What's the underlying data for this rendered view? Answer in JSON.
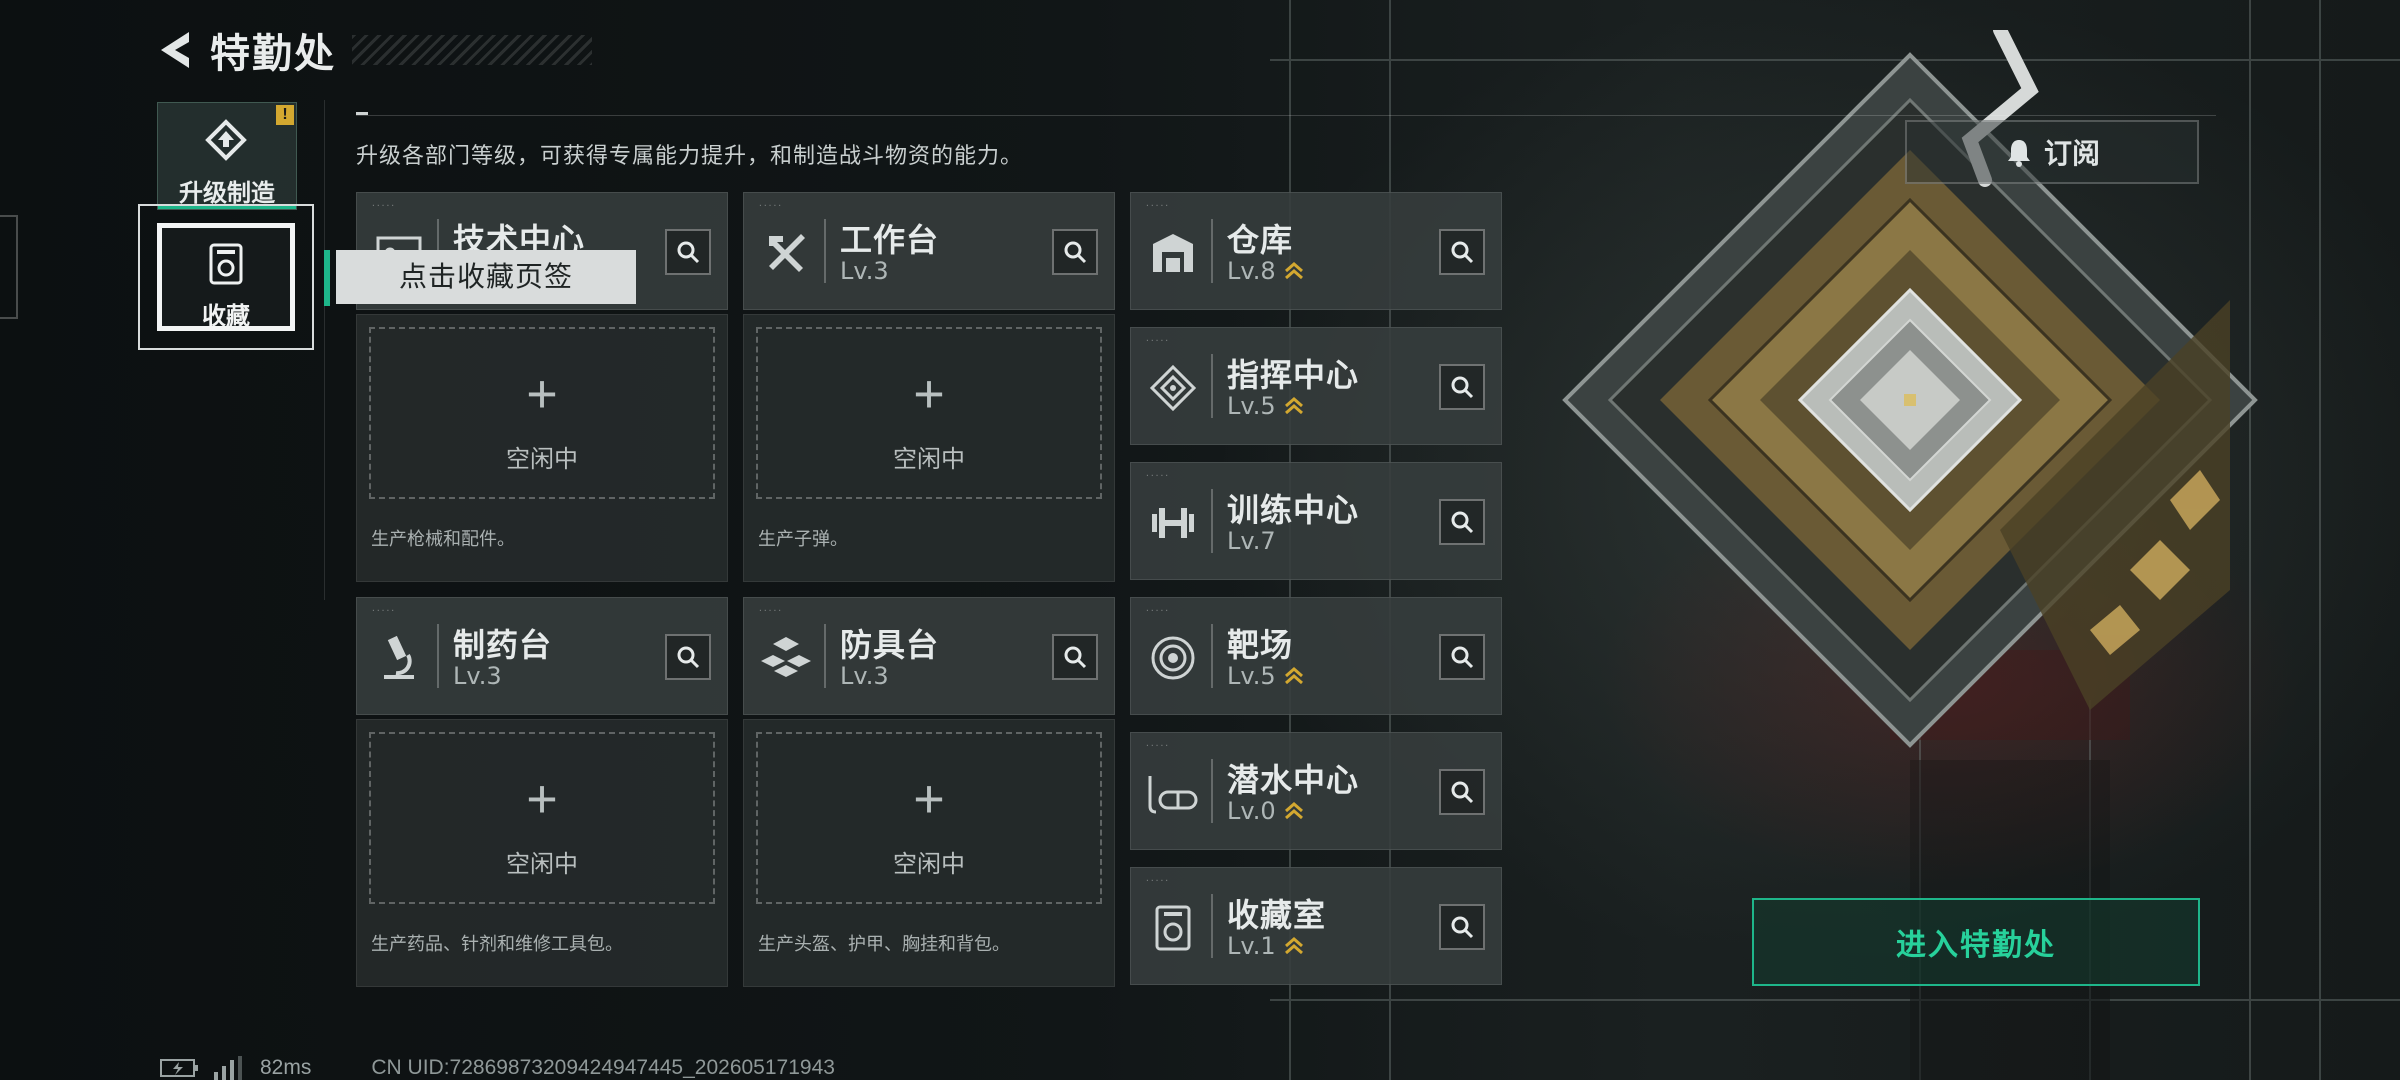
{
  "header": {
    "title": "特勤处"
  },
  "description": "升级各部门等级，可获得专属能力提升，和制造战斗物资的能力。",
  "nav": {
    "upgrade_label": "升级制造",
    "upgrade_badge": "!",
    "collect_label": "收藏"
  },
  "tooltip": "点击收藏页签",
  "subscribe_label": "订阅",
  "enter_label": "进入特勤处",
  "workshops": [
    {
      "name": "技术中心",
      "level": "",
      "idle": "空闲中",
      "note": "生产枪械和配件。"
    },
    {
      "name": "工作台",
      "level": "Lv.3",
      "idle": "空闲中",
      "note": "生产子弹。"
    },
    {
      "name": "制药台",
      "level": "Lv.3",
      "idle": "空闲中",
      "note": "生产药品、针剂和维修工具包。"
    },
    {
      "name": "防具台",
      "level": "Lv.3",
      "idle": "空闲中",
      "note": "生产头盔、护甲、胸挂和背包。"
    }
  ],
  "facilities": [
    {
      "name": "仓库",
      "level": "Lv.8",
      "icon": "warehouse-icon"
    },
    {
      "name": "指挥中心",
      "level": "Lv.5",
      "icon": "command-icon"
    },
    {
      "name": "训练中心",
      "level": "Lv.7",
      "icon": "dumbbell-icon"
    },
    {
      "name": "靶场",
      "level": "Lv.5",
      "icon": "target-icon"
    },
    {
      "name": "潜水中心",
      "level": "Lv.0",
      "icon": "diving-mask-icon"
    },
    {
      "name": "收藏室",
      "level": "Lv.1",
      "icon": "collection-icon"
    }
  ],
  "status": {
    "ping": "82ms",
    "uid": "CN UID:7286987320942494​7445_202605171943"
  },
  "colors": {
    "accent": "#1eb68a",
    "upgrade_chevron": "#d3a830"
  }
}
